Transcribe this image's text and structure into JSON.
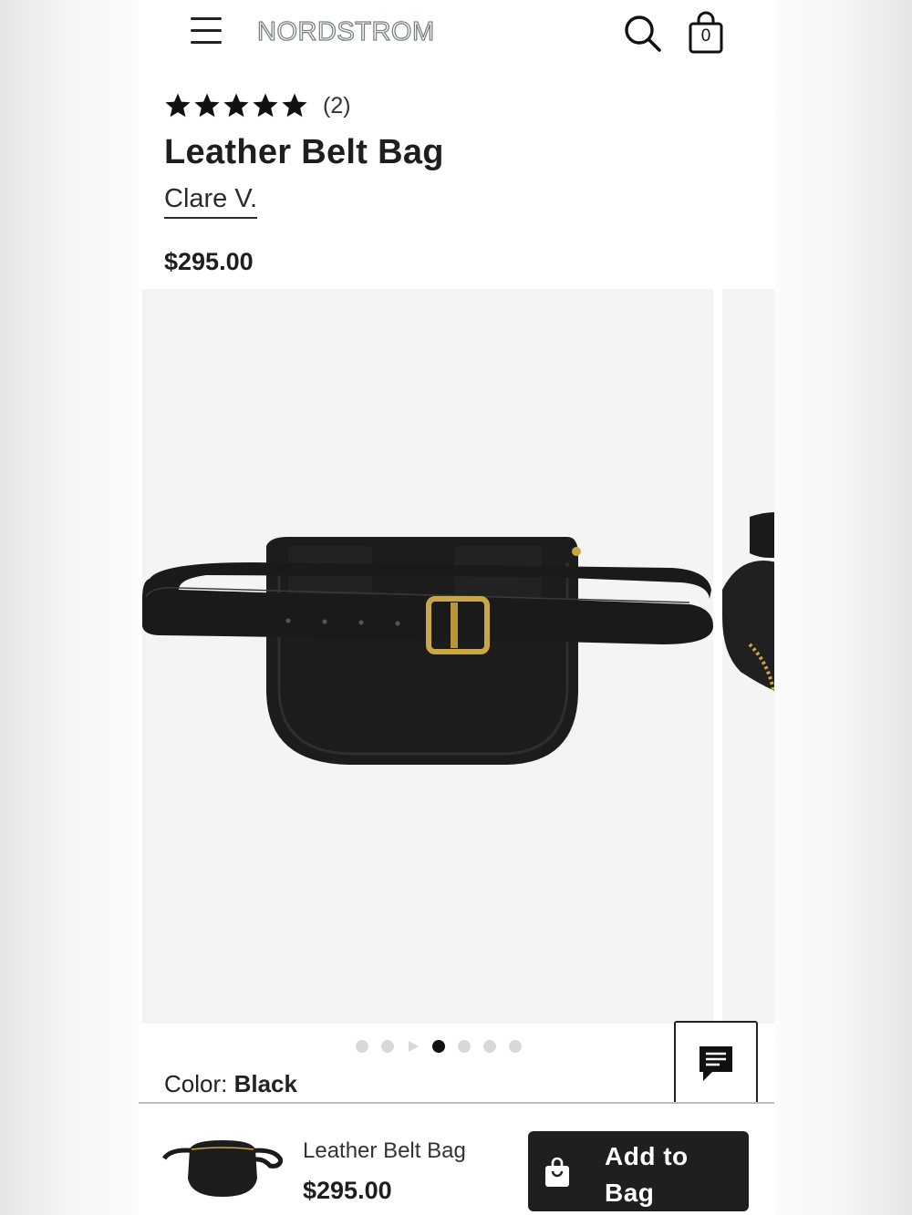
{
  "header": {
    "logo": "NORDSTROM",
    "bag_count": "0"
  },
  "product": {
    "rating": 5,
    "review_count": "(2)",
    "title": "Leather Belt Bag",
    "brand": "Clare V.",
    "price": "$295.00"
  },
  "gallery": {
    "dot_count": 7,
    "active_index": 3,
    "video_index": 2
  },
  "color": {
    "label": "Color:",
    "value": "Black"
  },
  "bottom_bar": {
    "title": "Leather Belt Bag",
    "price": "$295.00",
    "add_label_line1": "Add to",
    "add_label_line2": "Bag"
  },
  "colors": {
    "button_bg": "#1f1f1f",
    "logo_outline": "#7a8286",
    "buckle_gold": "#c9a646",
    "dot_inactive": "#d6d9dc"
  }
}
